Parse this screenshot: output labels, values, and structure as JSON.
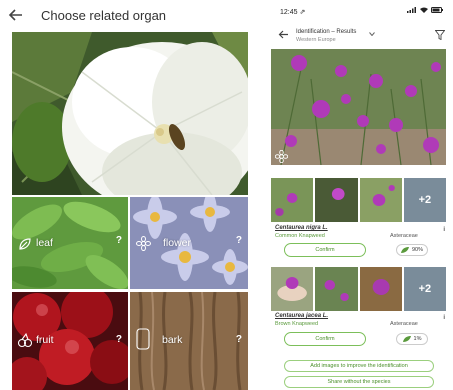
{
  "left": {
    "title": "Choose related organ",
    "organs": [
      {
        "label": "leaf",
        "badge": "?"
      },
      {
        "label": "flower",
        "badge": "?"
      },
      {
        "label": "fruit",
        "badge": "?"
      },
      {
        "label": "bark",
        "badge": "?"
      }
    ]
  },
  "right": {
    "status_time": "12:45 ⇗",
    "header_title": "Identification – Results",
    "header_region": "Western Europe",
    "results": [
      {
        "species": "Centaurea nigra L.",
        "common": "Common Knapweed",
        "family": "Asteraceae",
        "score": "90%",
        "more": "+2",
        "confirm": "Confirm",
        "info": "i"
      },
      {
        "species": "Centaurea jacea L.",
        "common": "Brown Knapweed",
        "family": "Asteraceae",
        "score": "1%",
        "more": "+2",
        "confirm": "Confirm",
        "info": "i"
      }
    ],
    "add_images_label": "Add images to improve the identification",
    "share_label": "Share without the species"
  },
  "colors": {
    "accent_green": "#5a9a3c",
    "confirm_border": "#7cbf5a"
  }
}
